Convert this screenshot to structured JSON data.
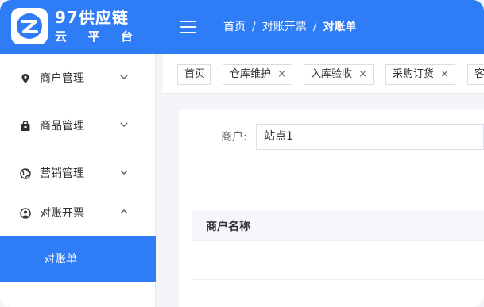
{
  "brand": {
    "title": "97供应链",
    "sub": [
      "云",
      "平",
      "台"
    ]
  },
  "breadcrumb": {
    "home": "首页",
    "sep": "/",
    "parent": "对账开票",
    "current": "对账单"
  },
  "sidebar": {
    "items": [
      {
        "label": "商户管理",
        "icon": "map-pin-icon",
        "expanded": false
      },
      {
        "label": "商品管理",
        "icon": "bag-icon",
        "expanded": false
      },
      {
        "label": "营销管理",
        "icon": "globe-icon",
        "expanded": false
      },
      {
        "label": "对账开票",
        "icon": "user-circle-icon",
        "expanded": true
      }
    ],
    "active_sub": "对账单"
  },
  "tags": [
    {
      "label": "首页",
      "closable": false
    },
    {
      "label": "仓库维护",
      "closable": true
    },
    {
      "label": "入库验收",
      "closable": true
    },
    {
      "label": "采购订货",
      "closable": true
    },
    {
      "label": "客",
      "closable": false
    }
  ],
  "filter": {
    "label": "商户:",
    "value": "站点1"
  },
  "table": {
    "headers": [
      "商户名称"
    ]
  },
  "colors": {
    "primary": "#2f7df6",
    "text": "#303133",
    "muted": "#606266"
  }
}
